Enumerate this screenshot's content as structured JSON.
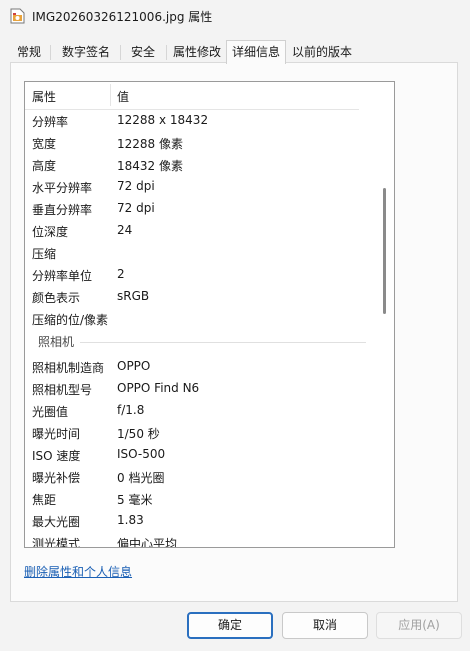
{
  "window": {
    "title": "IMG20260326121006.jpg 属性"
  },
  "tabs": [
    {
      "label": "常规"
    },
    {
      "label": "数字签名"
    },
    {
      "label": "安全"
    },
    {
      "label": "属性修改"
    },
    {
      "label": "详细信息"
    },
    {
      "label": "以前的版本"
    }
  ],
  "details": {
    "header": {
      "name": "属性",
      "value": "值"
    },
    "image_rows": [
      {
        "name": "分辨率",
        "value": "12288 x 18432"
      },
      {
        "name": "宽度",
        "value": "12288 像素"
      },
      {
        "name": "高度",
        "value": "18432 像素"
      },
      {
        "name": "水平分辨率",
        "value": "72 dpi"
      },
      {
        "name": "垂直分辨率",
        "value": "72 dpi"
      },
      {
        "name": "位深度",
        "value": "24"
      },
      {
        "name": "压缩",
        "value": ""
      },
      {
        "name": "分辨率单位",
        "value": "2"
      },
      {
        "name": "颜色表示",
        "value": "sRGB"
      },
      {
        "name": "压缩的位/像素",
        "value": ""
      }
    ],
    "camera_group": "照相机",
    "camera_rows": [
      {
        "name": "照相机制造商",
        "value": "OPPO"
      },
      {
        "name": "照相机型号",
        "value": "OPPO Find N6"
      },
      {
        "name": "光圈值",
        "value": "f/1.8"
      },
      {
        "name": "曝光时间",
        "value": "1/50 秒"
      },
      {
        "name": "ISO 速度",
        "value": "ISO-500"
      },
      {
        "name": "曝光补偿",
        "value": "0 档光圈"
      },
      {
        "name": "焦距",
        "value": "5 毫米"
      },
      {
        "name": "最大光圈",
        "value": "1.83"
      },
      {
        "name": "测光模式",
        "value": "偏中心平均"
      }
    ]
  },
  "remove_link": "删除属性和个人信息",
  "buttons": {
    "ok": "确定",
    "cancel": "取消",
    "apply": "应用(A)"
  }
}
